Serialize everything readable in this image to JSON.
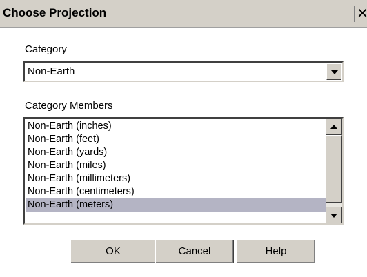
{
  "dialog": {
    "title": "Choose Projection",
    "close_glyph": "✕"
  },
  "category": {
    "label": "Category",
    "selected_value": "Non-Earth"
  },
  "members": {
    "label": "Category Members",
    "items": [
      "Non-Earth (inches)",
      "Non-Earth (feet)",
      "Non-Earth (yards)",
      "Non-Earth (miles)",
      "Non-Earth (millimeters)",
      "Non-Earth (centimeters)",
      "Non-Earth (meters)"
    ],
    "selected_index": 6
  },
  "buttons": {
    "ok": "OK",
    "cancel": "Cancel",
    "help": "Help"
  },
  "icons": {
    "close": "close-icon",
    "dropdown": "chevron-down-icon",
    "scroll_up": "scroll-up-arrow-icon",
    "scroll_down": "scroll-down-arrow-icon"
  },
  "colors": {
    "window_face": "#d4d0c8",
    "selection": "#b4b4c4"
  }
}
